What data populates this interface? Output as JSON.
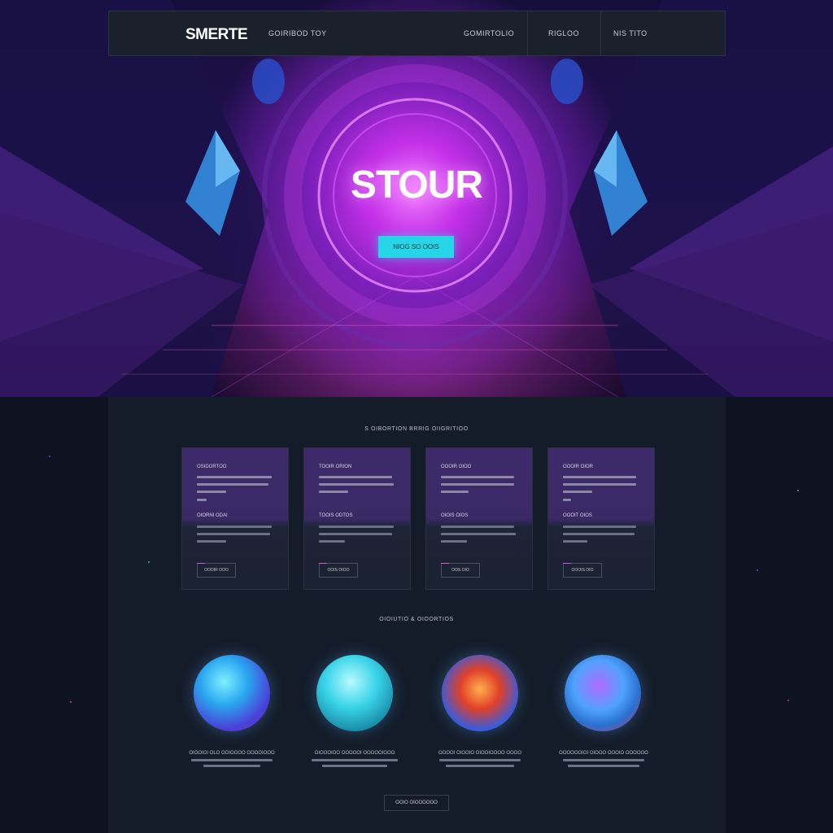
{
  "nav": {
    "logo": "SMERTE",
    "tagline": "GOIRIBOD TOY",
    "links": [
      "GOMIRTOLIO",
      "RIGLOO",
      "NIS TITO"
    ]
  },
  "hero": {
    "title": "STOUR",
    "button_label": "NIOG SO OOIS"
  },
  "features": {
    "heading": "S OIBORTION BRRIG OIIGRITIOO",
    "cards": [
      {
        "title": "OSIDORTOO",
        "subtitle": "OIORNI ODAI",
        "button": "OOOIR OOO"
      },
      {
        "title": "TOOIR ORION",
        "subtitle": "TOOIS ODTOS",
        "button": "OOIS OIOO"
      },
      {
        "title": "OOOIR OIOO",
        "subtitle": "OIOIS OIOS",
        "button": "OOS OIO"
      },
      {
        "title": "OOOIR OIOR",
        "subtitle": "OOOIT OIOS",
        "button": "OOOIS OIO"
      }
    ]
  },
  "gallery": {
    "heading": "OIOIUTIO & OIOORTIOS",
    "items": [
      {
        "caption": "OIOOIOI OLO OOIOOOO OOOOIOOO"
      },
      {
        "caption": "OIOOOIOO OOOOOI OOOOOIOOO"
      },
      {
        "caption": "OOOOI OIOOIO OIOOIOOOO OOOO"
      },
      {
        "caption": "OOOOOOIOI OIOOO OOOIO OOOOOO"
      }
    ],
    "footer_button": "OOIO OIOOOOOO"
  }
}
